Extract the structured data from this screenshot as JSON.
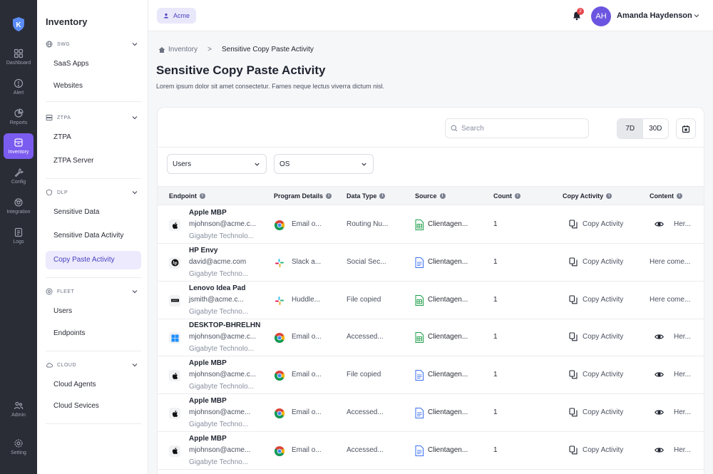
{
  "nav": {
    "items": [
      {
        "label": "Dashboard",
        "icon": "grid-icon"
      },
      {
        "label": "Alert",
        "icon": "alert-circle-icon"
      },
      {
        "label": "Reports",
        "icon": "pie-chart-icon"
      },
      {
        "label": "Inventory",
        "icon": "inventory-icon"
      },
      {
        "label": "Config",
        "icon": "wrench-icon"
      },
      {
        "label": "Integration",
        "icon": "integration-icon"
      },
      {
        "label": "Logs",
        "icon": "logs-icon"
      }
    ],
    "bottom": [
      {
        "label": "Admin",
        "icon": "users-icon"
      },
      {
        "label": "Setting",
        "icon": "gear-icon"
      }
    ],
    "active_color": "#7b5cf0"
  },
  "sidebar": {
    "title": "Inventory",
    "sections": [
      {
        "label": "SWG",
        "items": [
          "SaaS Apps",
          "Websites"
        ]
      },
      {
        "label": "ZTPA",
        "items": [
          "ZTPA",
          "ZTPA Server"
        ]
      },
      {
        "label": "DLP",
        "items": [
          "Sensitive Data",
          "Sensitive Data Activity",
          "Copy Paste Activity"
        ]
      },
      {
        "label": "FLEET",
        "items": [
          "Users",
          "Endpoints"
        ]
      },
      {
        "label": "CLOUD",
        "items": [
          "Cloud Agents",
          "Cloud Sevices"
        ]
      }
    ],
    "active_item": "Copy Paste Activity"
  },
  "topbar": {
    "org": "Acme",
    "notifications": "2",
    "user_initials": "AH",
    "user_name": "Amanda Haydenson"
  },
  "breadcrumb": {
    "root": "Inventory",
    "sep": ">",
    "current": "Sensitive Copy Paste Activity"
  },
  "page": {
    "title": "Sensitive Copy Paste Activity",
    "subtitle": "Lorem ipsum dolor sit amet consectetur. Fames neque lectus viverra dictum nisl."
  },
  "toolbar": {
    "search_placeholder": "Search",
    "range_7d": "7D",
    "range_30d": "30D",
    "range_selected": "7D"
  },
  "filters": {
    "users": "Users",
    "os": "OS"
  },
  "table": {
    "columns": [
      "Endpoint",
      "Program Details",
      "Data Type",
      "Source",
      "Count",
      "Copy Activity",
      "Content"
    ],
    "rows": [
      {
        "os": "apple",
        "name": "Apple MBP",
        "email": "mjohnson@acme.c...",
        "company": "Gigabyte Technolo...",
        "program_icon": "chrome",
        "program": "Email o...",
        "data_type": "Routing Nu...",
        "source_icon": "sheet",
        "source": "Clientagen...",
        "count": "1",
        "copy": "Copy Activity",
        "content_eye": true,
        "content": "Her..."
      },
      {
        "os": "hp",
        "name": "HP Envy",
        "email": "david@acme.com",
        "company": "Gigabyte Techno...",
        "program_icon": "slack",
        "program": "Slack a...",
        "data_type": "Social Sec...",
        "source_icon": "doc",
        "source": "Clientagen...",
        "count": "1",
        "copy": "Copy Activity",
        "content_eye": false,
        "content": "Here come..."
      },
      {
        "os": "lenovo",
        "name": "Lenovo Idea Pad",
        "email": "jsmith@acme.c...",
        "company": "Gigabyte Techno...",
        "program_icon": "slack",
        "program": "Huddle...",
        "data_type": "File copied",
        "source_icon": "sheet",
        "source": "Clientagen...",
        "count": "1",
        "copy": "Copy Activity",
        "content_eye": false,
        "content": "Here come..."
      },
      {
        "os": "windows",
        "name": "DESKTOP-BHRELHN",
        "email": "mjohnson@acme.c...",
        "company": "Gigabyte Technolo...",
        "program_icon": "chrome",
        "program": "Email o...",
        "data_type": "Accessed...",
        "source_icon": "sheet",
        "source": "Clientagen...",
        "count": "1",
        "copy": "Copy Activity",
        "content_eye": true,
        "content": "Her..."
      },
      {
        "os": "apple",
        "name": "Apple MBP",
        "email": "mjohnson@acme.c...",
        "company": "Gigabyte Technolo...",
        "program_icon": "chrome",
        "program": "Email o...",
        "data_type": "File copied",
        "source_icon": "doc",
        "source": "Clientagen...",
        "count": "1",
        "copy": "Copy Activity",
        "content_eye": true,
        "content": "Her..."
      },
      {
        "os": "apple",
        "name": "Apple MBP",
        "email": "mjohnson@acme...",
        "company": "Gigabyte Techno...",
        "program_icon": "chrome",
        "program": "Email o...",
        "data_type": "Accessed...",
        "source_icon": "doc",
        "source": "Clientagen...",
        "count": "1",
        "copy": "Copy Activity",
        "content_eye": true,
        "content": "Her..."
      },
      {
        "os": "apple",
        "name": "Apple MBP",
        "email": "mjohnson@acme...",
        "company": "Gigabyte Techno...",
        "program_icon": "chrome",
        "program": "Email o...",
        "data_type": "Accessed...",
        "source_icon": "doc",
        "source": "Clientagen...",
        "count": "1",
        "copy": "Copy Activity",
        "content_eye": true,
        "content": "Her..."
      }
    ]
  }
}
